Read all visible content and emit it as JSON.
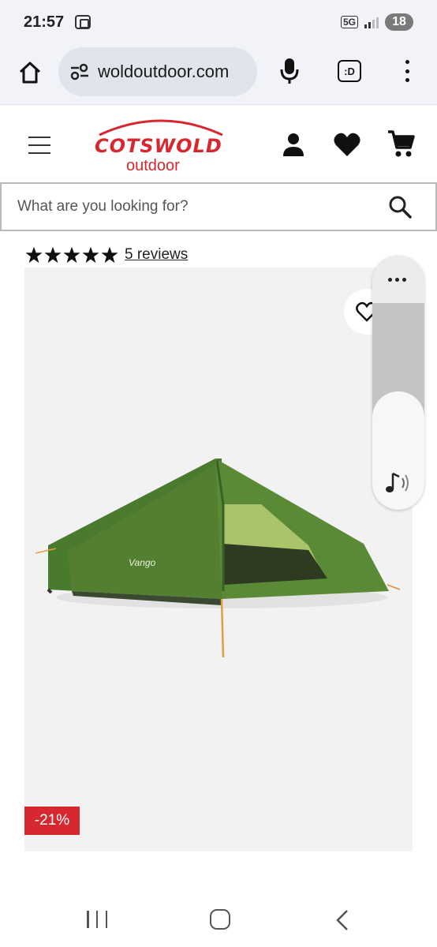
{
  "status_bar": {
    "time": "21:57",
    "network": "5G",
    "battery": "18"
  },
  "browser": {
    "url": "woldoutdoor.com",
    "tab_label": ":D"
  },
  "site": {
    "logo_main": "COTSWOLD",
    "logo_sub": "outdoor",
    "search_placeholder": "What are you looking for?"
  },
  "product": {
    "rating": 5,
    "rating_max": 5,
    "reviews_label": "5 reviews",
    "discount_label": "-21%",
    "brand_on_image": "Vango"
  },
  "volume_panel": {
    "level": 0.47
  },
  "colors": {
    "brand_red": "#d8282f",
    "tent_green": "#4a7a2e",
    "browser_bg": "#f1f3f8"
  },
  "icons": {
    "home": "home-icon",
    "mic": "microphone-icon",
    "menu": "more-vert-icon",
    "account": "person-icon",
    "wishlist": "heart-icon",
    "cart": "cart-icon",
    "search": "search-icon",
    "star": "star-icon",
    "volume": "music-note-volume-icon"
  }
}
